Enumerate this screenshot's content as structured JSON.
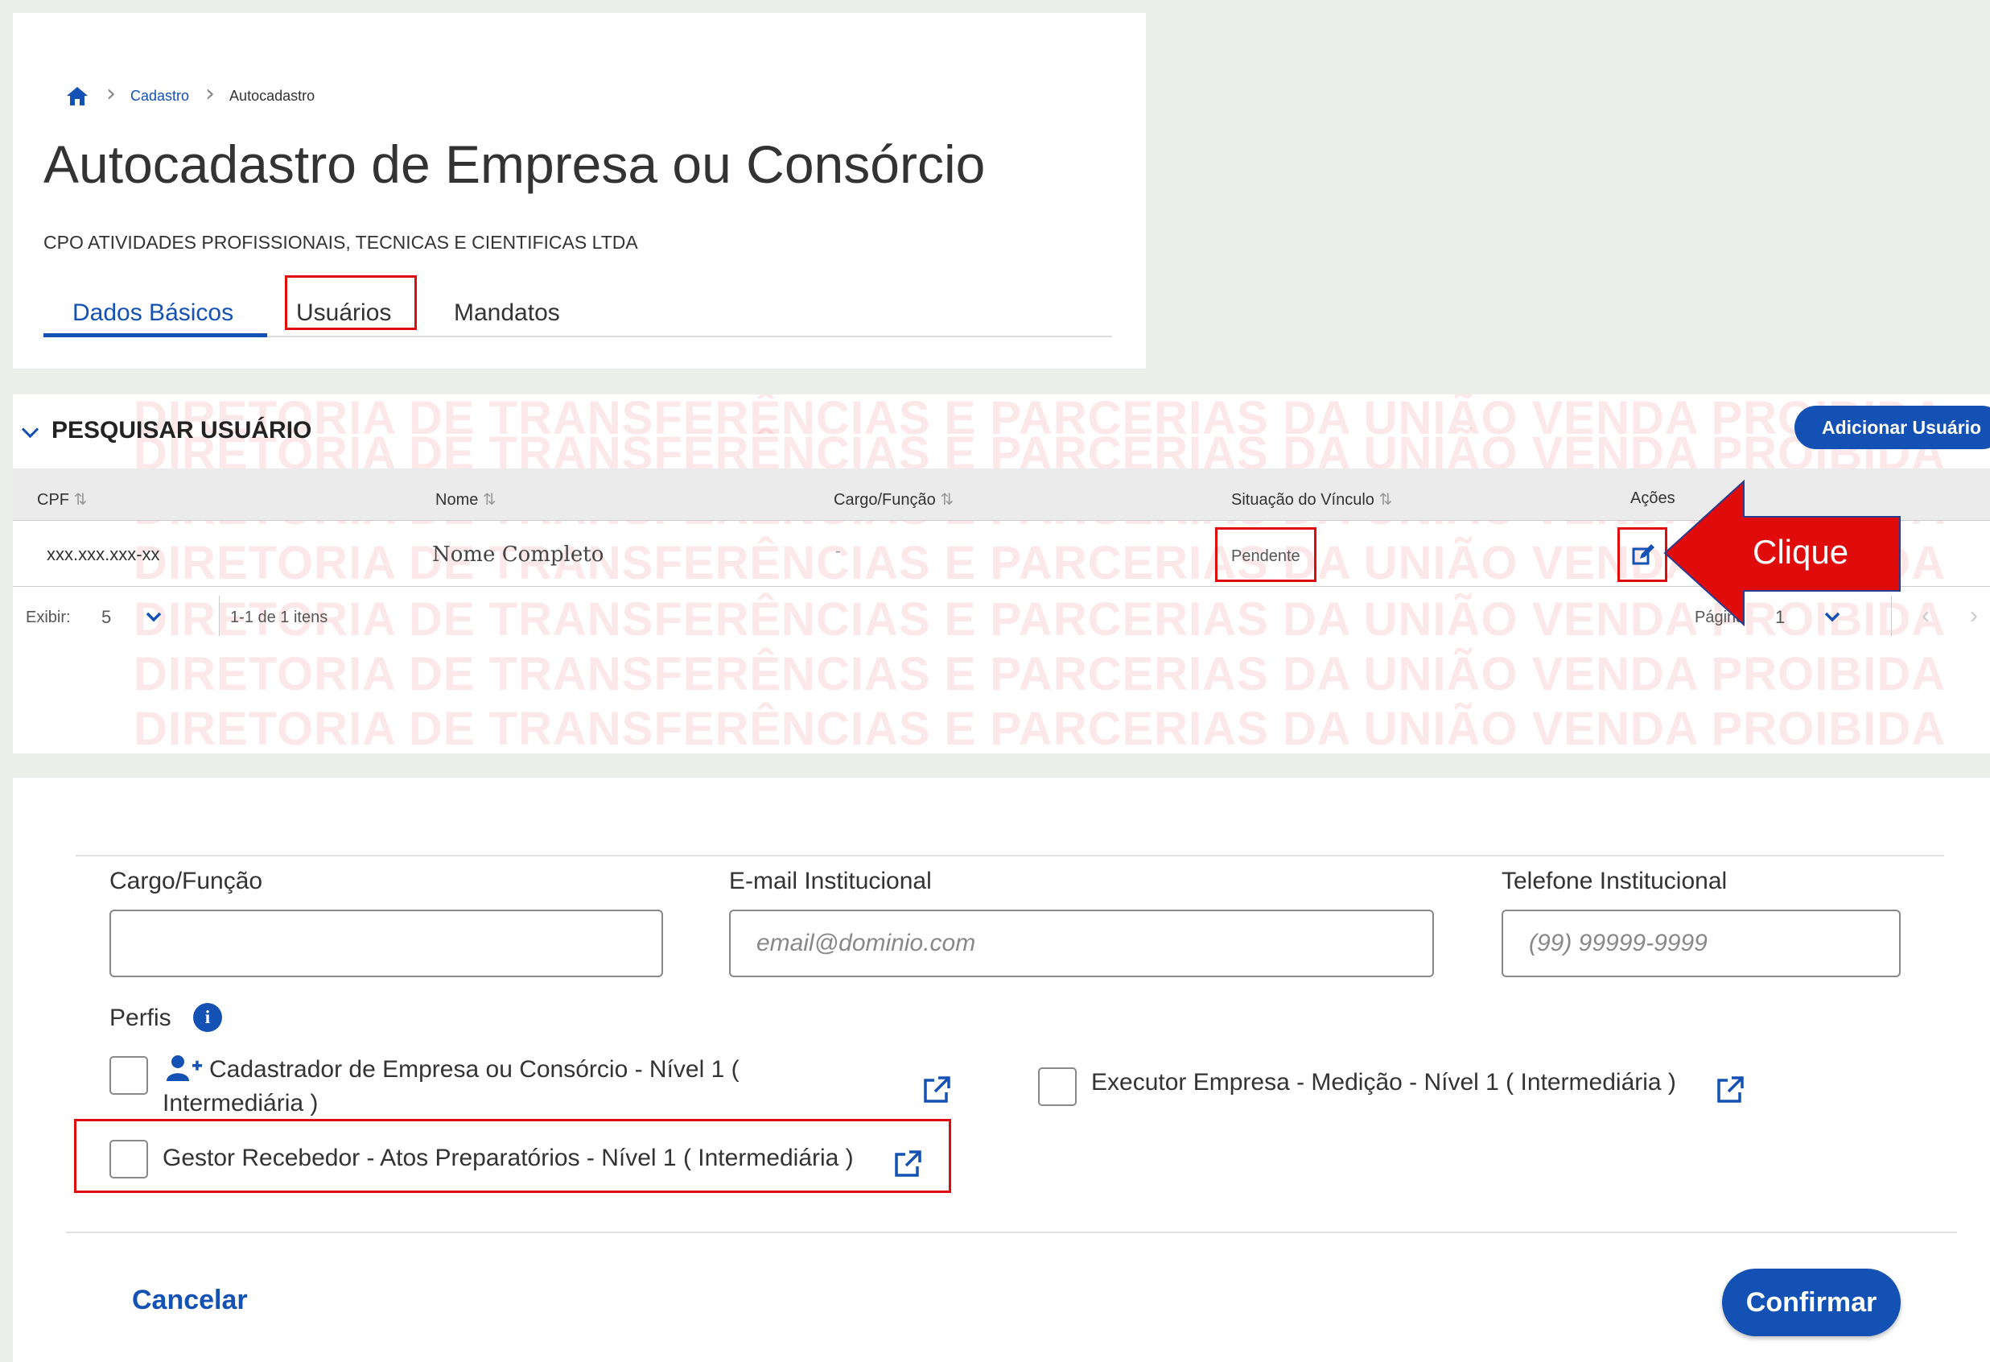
{
  "breadcrumb": {
    "items": [
      "Cadastro",
      "Autocadastro"
    ]
  },
  "page_title": "Autocadastro de Empresa ou Consórcio",
  "company_name": "CPO ATIVIDADES PROFISSIONAIS, TECNICAS E CIENTIFICAS LTDA",
  "tabs": [
    {
      "label": "Dados Básicos",
      "active": true
    },
    {
      "label": "Usuários",
      "active": false
    },
    {
      "label": "Mandatos",
      "active": false
    }
  ],
  "search_section": {
    "title": "PESQUISAR USUÁRIO",
    "add_button": "Adicionar Usuário",
    "watermark": "DIRETORIA DE TRANSFERÊNCIAS E PARCERIAS DA UNIÃO VENDA PROIBIDA",
    "table": {
      "columns": [
        "CPF",
        "Nome",
        "Cargo/Função",
        "Situação do Vínculo",
        "Ações"
      ],
      "rows": [
        {
          "cpf": "xxx.xxx.xxx-xx",
          "nome": "Nome Completo",
          "cargo": "-",
          "situacao": "Pendente"
        }
      ]
    },
    "pagination": {
      "show_label": "Exibir:",
      "page_size": "5",
      "items_info": "1-1 de 1 itens",
      "page_label": "Página",
      "page": "1"
    }
  },
  "callout": {
    "label": "Clique",
    "color": "#e00b0b"
  },
  "form": {
    "cargo": {
      "label": "Cargo/Função",
      "value": "",
      "placeholder": ""
    },
    "email": {
      "label": "E-mail Institucional",
      "placeholder": "email@dominio.com"
    },
    "telefone": {
      "label": "Telefone Institucional",
      "placeholder": "(99) 99999-9999"
    },
    "perfis_label": "Perfis",
    "perfis": [
      {
        "line1": "Cadastrador de Empresa ou Consórcio - Nível 1 (",
        "line2": "Intermediária )",
        "checked": false
      },
      {
        "label": "Executor Empresa - Medição - Nível 1 ( Intermediária )",
        "checked": false
      },
      {
        "label": "Gestor Recebedor - Atos Preparatórios - Nível 1 ( Intermediária )",
        "checked": false
      }
    ],
    "cancel": "Cancelar",
    "confirm": "Confirmar"
  },
  "colors": {
    "primary": "#1351b4",
    "highlight": "#e00b0b",
    "background": "#eceee9"
  }
}
